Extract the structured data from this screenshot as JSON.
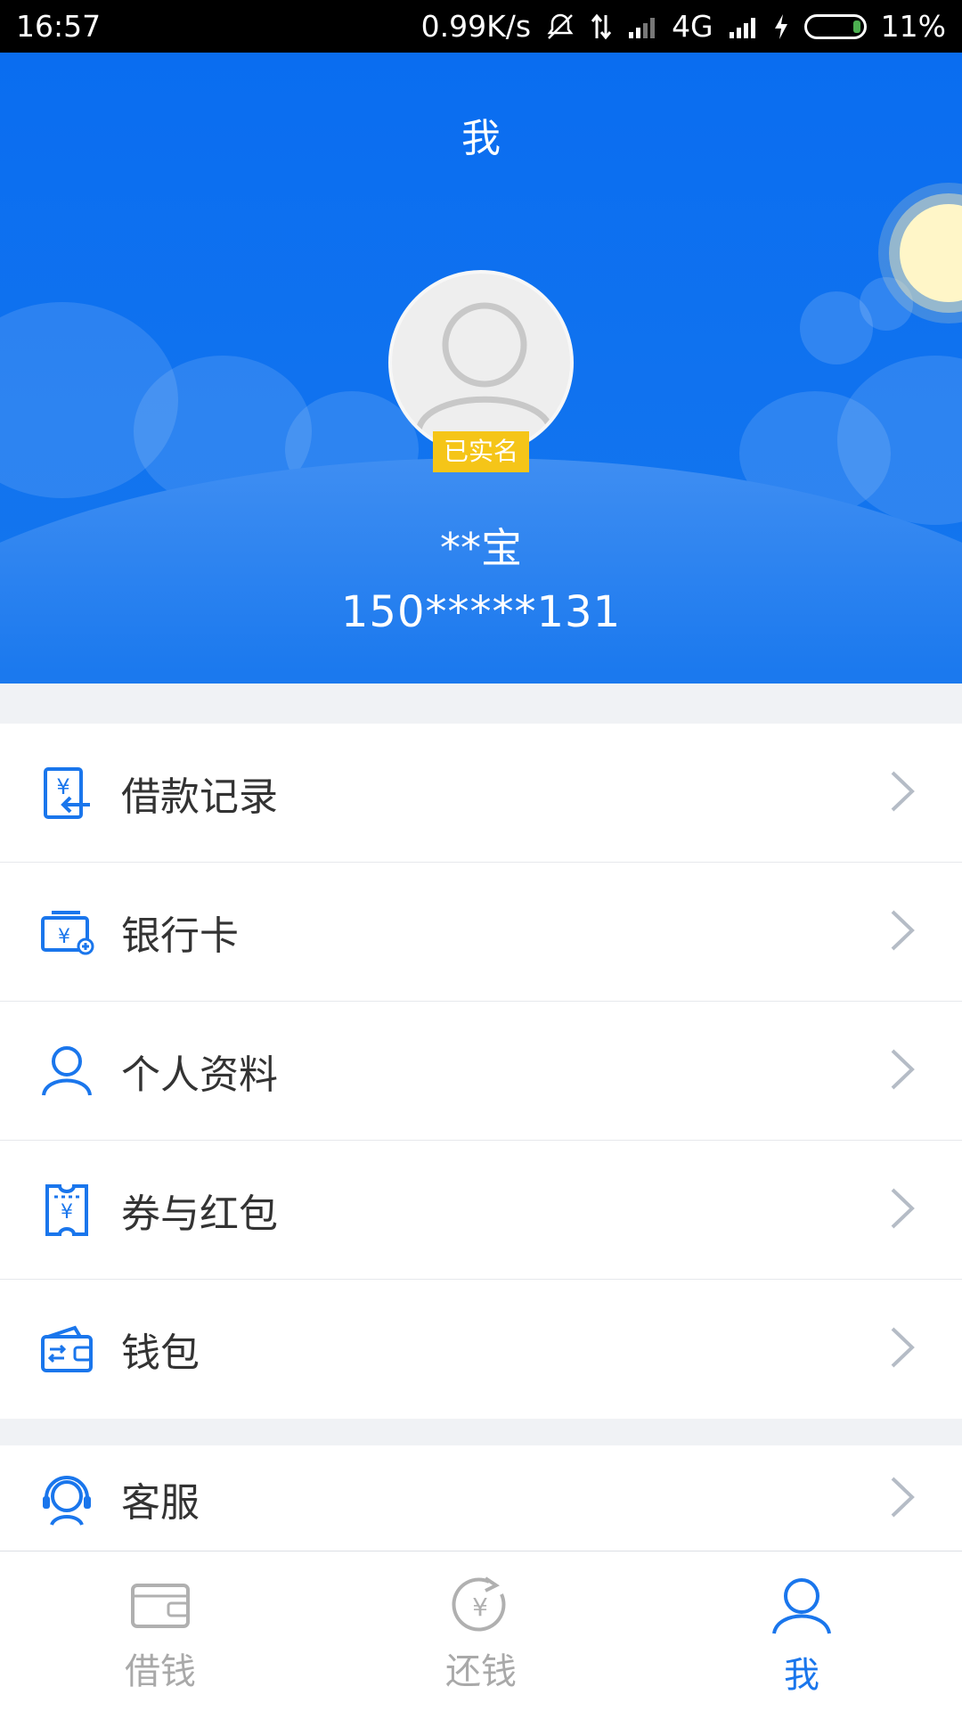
{
  "status_bar": {
    "time": "16:57",
    "net_speed": "0.99K/s",
    "network": "4G",
    "battery": "11%"
  },
  "header": {
    "title": "我",
    "badge": "已实名",
    "user_name": "**宝",
    "phone": "150*****131"
  },
  "menu": {
    "loan_records": "借款记录",
    "bank_card": "银行卡",
    "profile": "个人资料",
    "coupons": "券与红包",
    "wallet": "钱包",
    "customer_service": "客服"
  },
  "tabs": {
    "borrow": "借钱",
    "repay": "还钱",
    "me": "我"
  },
  "colors": {
    "primary": "#1a76ec",
    "badge": "#f5c518",
    "inactive": "#a9a9a9"
  }
}
